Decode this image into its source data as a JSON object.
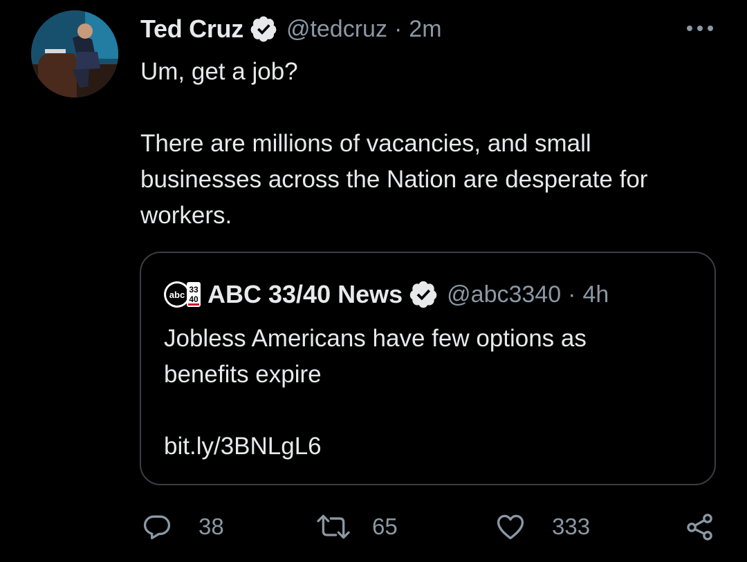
{
  "tweet": {
    "author_name": "Ted Cruz",
    "handle": "@tedcruz",
    "separator": "·",
    "time": "2m",
    "text": "Um, get a job?\n\nThere are millions of vacancies, and small\nbusinesses across the Nation are desperate for\nworkers.",
    "avatar_icon": "profile-photo-icon",
    "verified_icon": "verified-badge-icon",
    "more_icon": "more-options-icon"
  },
  "quoted_tweet": {
    "author_name": "ABC 33/40 News",
    "handle": "@abc3340",
    "separator": "·",
    "time": "4h",
    "text": "Jobless Americans have few options as\nbenefits expire\n\nbit.ly/3BNLgL6",
    "logo_icon": "abc-3340-logo",
    "verified_icon": "verified-badge-icon"
  },
  "actions": {
    "reply": {
      "icon": "reply-icon",
      "count": "38"
    },
    "retweet": {
      "icon": "retweet-icon",
      "count": "65"
    },
    "like": {
      "icon": "heart-icon",
      "count": "333"
    },
    "share": {
      "icon": "share-icon"
    }
  },
  "colors": {
    "background": "#000000",
    "primary_text": "#e7e9ea",
    "secondary_text": "#8b98a5",
    "border": "#3a3f44"
  }
}
